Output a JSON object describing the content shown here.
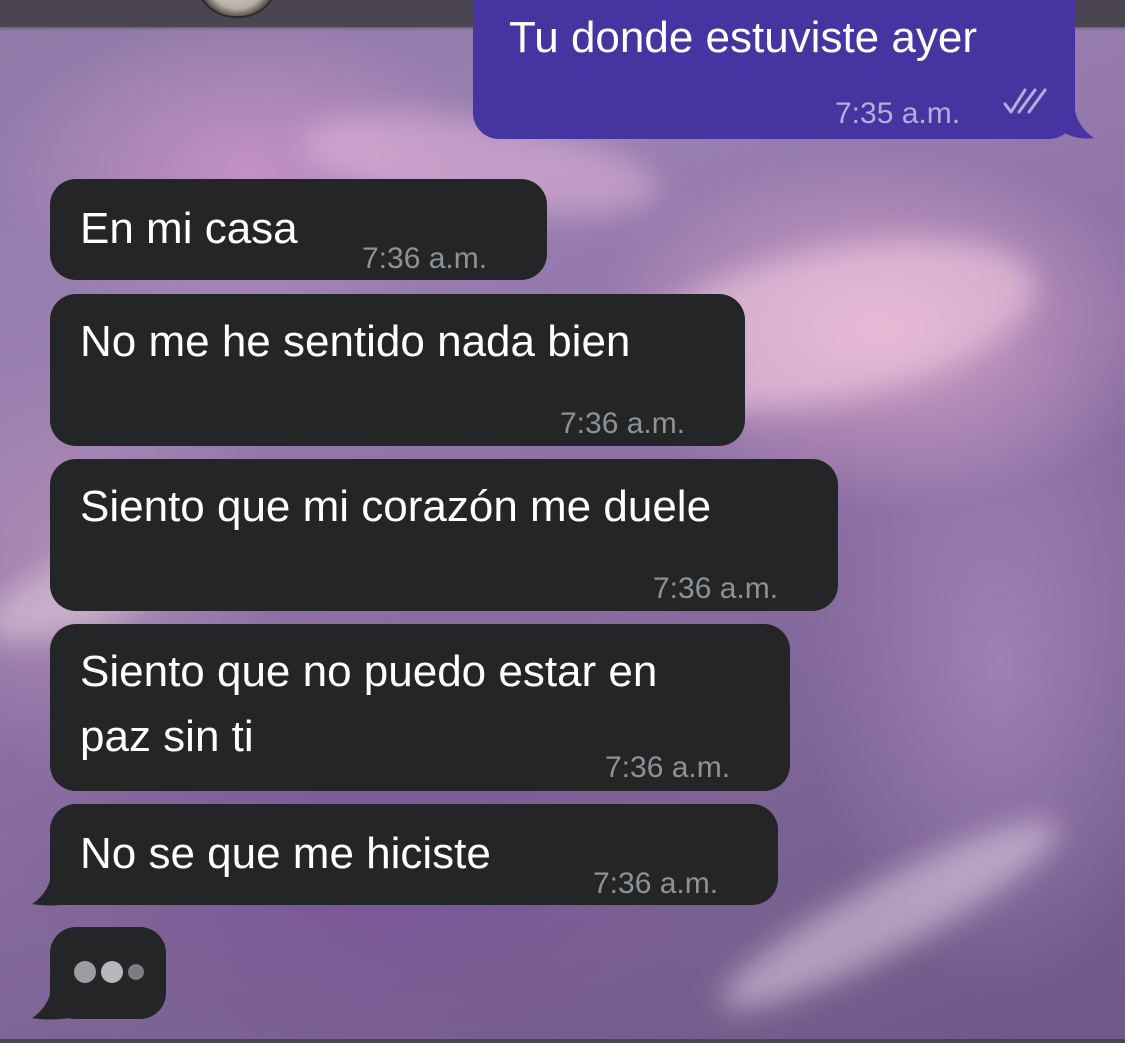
{
  "conversation": {
    "outgoing": {
      "text": "Tu donde estuviste ayer",
      "time": "7:35 a.m.",
      "status_icon": "double-check-icon"
    },
    "incoming": [
      {
        "lines": [
          "En mi casa"
        ],
        "time": "7:36 a.m."
      },
      {
        "lines": [
          "No me he sentido nada bien"
        ],
        "time": "7:36 a.m."
      },
      {
        "lines": [
          "Siento que mi corazón me duele"
        ],
        "time": "7:36 a.m."
      },
      {
        "lines": [
          "Siento que no puedo estar en",
          "paz sin ti"
        ],
        "time": "7:36 a.m."
      },
      {
        "lines": [
          "No se que me hiciste"
        ],
        "time": "7:36 a.m."
      }
    ],
    "typing_indicator_icon": "typing-dots-icon"
  },
  "colors": {
    "incoming_bubble": "#232526",
    "outgoing_bubble": "#4634a0",
    "timestamp": "#8f9295"
  }
}
